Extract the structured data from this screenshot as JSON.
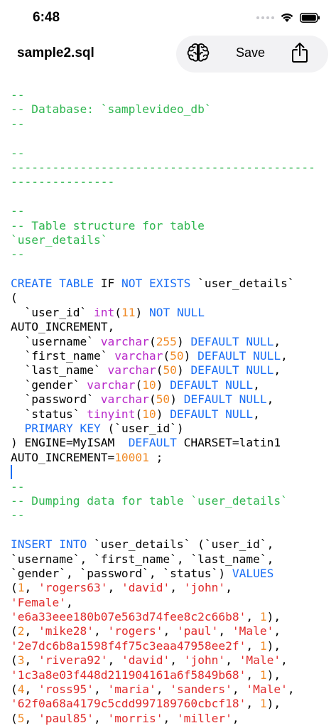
{
  "status_bar": {
    "time": "6:48"
  },
  "nav": {
    "title": "sample2.sql",
    "save_label": "Save"
  },
  "icons": {
    "brain": "brain-icon",
    "share": "share-icon",
    "wifi": "wifi-icon",
    "battery": "battery-icon"
  },
  "colors": {
    "comment": "#2fb650",
    "keyword": "#1a6ef5",
    "type": "#b829c9",
    "number": "#f08a26",
    "string": "#e02b2b",
    "plain": "#000000",
    "toolbar_bg": "#f2f2f4"
  },
  "editor": {
    "lines": [
      [
        [
          "c",
          "--"
        ]
      ],
      [
        [
          "c",
          "-- Database: `samplevideo_db`"
        ]
      ],
      [
        [
          "c",
          "--"
        ]
      ],
      [],
      [
        [
          "c",
          "--"
        ]
      ],
      [
        [
          "c",
          "--------------------------------------------"
        ]
      ],
      [
        [
          "c",
          "---------------"
        ]
      ],
      [],
      [
        [
          "c",
          "--"
        ]
      ],
      [
        [
          "c",
          "-- Table structure for table"
        ]
      ],
      [
        [
          "c",
          "`user_details`"
        ]
      ],
      [
        [
          "c",
          "--"
        ]
      ],
      [],
      [
        [
          "k",
          "CREATE"
        ],
        [
          "p",
          " "
        ],
        [
          "k",
          "TABLE"
        ],
        [
          "p",
          " IF "
        ],
        [
          "k",
          "NOT"
        ],
        [
          "p",
          " "
        ],
        [
          "k",
          "EXISTS"
        ],
        [
          "p",
          " `user_details`"
        ]
      ],
      [
        [
          "p",
          "("
        ]
      ],
      [
        [
          "p",
          "  `user_id` "
        ],
        [
          "t",
          "int"
        ],
        [
          "p",
          "("
        ],
        [
          "n",
          "11"
        ],
        [
          "p",
          ") "
        ],
        [
          "k",
          "NOT"
        ],
        [
          "p",
          " "
        ],
        [
          "k",
          "NULL"
        ]
      ],
      [
        [
          "p",
          "AUTO_INCREMENT,"
        ]
      ],
      [
        [
          "p",
          "  `username` "
        ],
        [
          "t",
          "varchar"
        ],
        [
          "p",
          "("
        ],
        [
          "n",
          "255"
        ],
        [
          "p",
          ") "
        ],
        [
          "k",
          "DEFAULT"
        ],
        [
          "p",
          " "
        ],
        [
          "k",
          "NULL"
        ],
        [
          "p",
          ","
        ]
      ],
      [
        [
          "p",
          "  `first_name` "
        ],
        [
          "t",
          "varchar"
        ],
        [
          "p",
          "("
        ],
        [
          "n",
          "50"
        ],
        [
          "p",
          ") "
        ],
        [
          "k",
          "DEFAULT"
        ],
        [
          "p",
          " "
        ],
        [
          "k",
          "NULL"
        ],
        [
          "p",
          ","
        ]
      ],
      [
        [
          "p",
          "  `last_name` "
        ],
        [
          "t",
          "varchar"
        ],
        [
          "p",
          "("
        ],
        [
          "n",
          "50"
        ],
        [
          "p",
          ") "
        ],
        [
          "k",
          "DEFAULT"
        ],
        [
          "p",
          " "
        ],
        [
          "k",
          "NULL"
        ],
        [
          "p",
          ","
        ]
      ],
      [
        [
          "p",
          "  `gender` "
        ],
        [
          "t",
          "varchar"
        ],
        [
          "p",
          "("
        ],
        [
          "n",
          "10"
        ],
        [
          "p",
          ") "
        ],
        [
          "k",
          "DEFAULT"
        ],
        [
          "p",
          " "
        ],
        [
          "k",
          "NULL"
        ],
        [
          "p",
          ","
        ]
      ],
      [
        [
          "p",
          "  `password` "
        ],
        [
          "t",
          "varchar"
        ],
        [
          "p",
          "("
        ],
        [
          "n",
          "50"
        ],
        [
          "p",
          ") "
        ],
        [
          "k",
          "DEFAULT"
        ],
        [
          "p",
          " "
        ],
        [
          "k",
          "NULL"
        ],
        [
          "p",
          ","
        ]
      ],
      [
        [
          "p",
          "  `status` "
        ],
        [
          "t",
          "tinyint"
        ],
        [
          "p",
          "("
        ],
        [
          "n",
          "10"
        ],
        [
          "p",
          ") "
        ],
        [
          "k",
          "DEFAULT"
        ],
        [
          "p",
          " "
        ],
        [
          "k",
          "NULL"
        ],
        [
          "p",
          ","
        ]
      ],
      [
        [
          "p",
          "  "
        ],
        [
          "k",
          "PRIMARY"
        ],
        [
          "p",
          " "
        ],
        [
          "k",
          "KEY"
        ],
        [
          "p",
          " (`user_id`)"
        ]
      ],
      [
        [
          "p",
          ") ENGINE=MyISAM  "
        ],
        [
          "k",
          "DEFAULT"
        ],
        [
          "p",
          " CHARSET=latin1"
        ]
      ],
      [
        [
          "p",
          "AUTO_INCREMENT="
        ],
        [
          "n",
          "10001"
        ],
        [
          "p",
          " ;"
        ]
      ],
      [
        [
          "cursor",
          ""
        ]
      ],
      [
        [
          "c",
          "--"
        ]
      ],
      [
        [
          "c",
          "-- Dumping data for table `user_details`"
        ]
      ],
      [
        [
          "c",
          "--"
        ]
      ],
      [],
      [
        [
          "k",
          "INSERT"
        ],
        [
          "p",
          " "
        ],
        [
          "k",
          "INTO"
        ],
        [
          "p",
          " `user_details` (`user_id`,"
        ]
      ],
      [
        [
          "p",
          "`username`, `first_name`, `last_name`,"
        ]
      ],
      [
        [
          "p",
          "`gender`, `password`, `status`) "
        ],
        [
          "k",
          "VALUES"
        ]
      ],
      [
        [
          "p",
          "("
        ],
        [
          "n",
          "1"
        ],
        [
          "p",
          ", "
        ],
        [
          "s",
          "'rogers63'"
        ],
        [
          "p",
          ", "
        ],
        [
          "s",
          "'david'"
        ],
        [
          "p",
          ", "
        ],
        [
          "s",
          "'john'"
        ],
        [
          "p",
          ","
        ]
      ],
      [
        [
          "s",
          "'Female'"
        ],
        [
          "p",
          ","
        ]
      ],
      [
        [
          "s",
          "'e6a33eee180b07e563d74fee8c2c66b8'"
        ],
        [
          "p",
          ", "
        ],
        [
          "n",
          "1"
        ],
        [
          "p",
          "),"
        ]
      ],
      [
        [
          "p",
          "("
        ],
        [
          "n",
          "2"
        ],
        [
          "p",
          ", "
        ],
        [
          "s",
          "'mike28'"
        ],
        [
          "p",
          ", "
        ],
        [
          "s",
          "'rogers'"
        ],
        [
          "p",
          ", "
        ],
        [
          "s",
          "'paul'"
        ],
        [
          "p",
          ", "
        ],
        [
          "s",
          "'Male'"
        ],
        [
          "p",
          ","
        ]
      ],
      [
        [
          "s",
          "'2e7dc6b8a1598f4f75c3eaa47958ee2f'"
        ],
        [
          "p",
          ", "
        ],
        [
          "n",
          "1"
        ],
        [
          "p",
          "),"
        ]
      ],
      [
        [
          "p",
          "("
        ],
        [
          "n",
          "3"
        ],
        [
          "p",
          ", "
        ],
        [
          "s",
          "'rivera92'"
        ],
        [
          "p",
          ", "
        ],
        [
          "s",
          "'david'"
        ],
        [
          "p",
          ", "
        ],
        [
          "s",
          "'john'"
        ],
        [
          "p",
          ", "
        ],
        [
          "s",
          "'Male'"
        ],
        [
          "p",
          ","
        ]
      ],
      [
        [
          "s",
          "'1c3a8e03f448d211904161a6f5849b68'"
        ],
        [
          "p",
          ", "
        ],
        [
          "n",
          "1"
        ],
        [
          "p",
          "),"
        ]
      ],
      [
        [
          "p",
          "("
        ],
        [
          "n",
          "4"
        ],
        [
          "p",
          ", "
        ],
        [
          "s",
          "'ross95'"
        ],
        [
          "p",
          ", "
        ],
        [
          "s",
          "'maria'"
        ],
        [
          "p",
          ", "
        ],
        [
          "s",
          "'sanders'"
        ],
        [
          "p",
          ", "
        ],
        [
          "s",
          "'Male'"
        ],
        [
          "p",
          ","
        ]
      ],
      [
        [
          "s",
          "'62f0a68a4179c5cdd997189760cbcf18'"
        ],
        [
          "p",
          ", "
        ],
        [
          "n",
          "1"
        ],
        [
          "p",
          "),"
        ]
      ],
      [
        [
          "p",
          "("
        ],
        [
          "n",
          "5"
        ],
        [
          "p",
          ", "
        ],
        [
          "s",
          "'paul85'"
        ],
        [
          "p",
          ", "
        ],
        [
          "s",
          "'morris'"
        ],
        [
          "p",
          ", "
        ],
        [
          "s",
          "'miller'"
        ],
        [
          "p",
          ","
        ]
      ]
    ]
  }
}
